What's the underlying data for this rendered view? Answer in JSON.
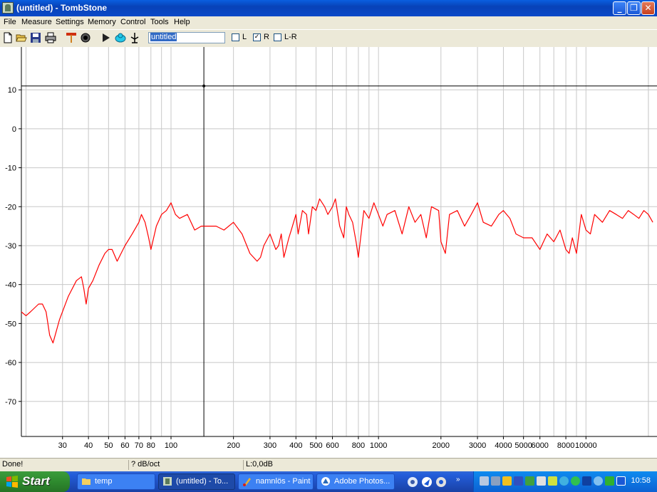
{
  "window": {
    "title": "(untitled) - TombStone",
    "minimize_glyph": "_",
    "maximize_glyph": "❐",
    "close_glyph": "✕"
  },
  "menu": [
    "File",
    "Measure",
    "Settings",
    "Memory",
    "Control",
    "Tools",
    "Help"
  ],
  "toolbar": {
    "icons": [
      "new-icon",
      "open-icon",
      "save-icon",
      "print-icon",
      "marker-icon",
      "record-icon",
      "play-icon",
      "loop-icon",
      "tuning-fork-icon"
    ],
    "name_value": "untitled",
    "checkboxes": [
      {
        "label": "L",
        "checked": false
      },
      {
        "label": "R",
        "checked": true
      },
      {
        "label": "L-R",
        "checked": false
      }
    ]
  },
  "chart_data": {
    "type": "line",
    "x_scale": "log",
    "xlim": [
      19,
      22000
    ],
    "ylim": [
      -79,
      21
    ],
    "x_tick_labels": [
      "30",
      "40",
      "50",
      "60",
      "70",
      "80",
      "100",
      "200",
      "300",
      "400",
      "500",
      "600",
      "800",
      "1000",
      "2000",
      "3000",
      "4000",
      "5000",
      "6000",
      "8000",
      "10000"
    ],
    "y_tick_labels": [
      "10",
      "0",
      "-10",
      "-20",
      "-30",
      "-40",
      "-50",
      "-60",
      "-70"
    ],
    "grid": true,
    "cursor": {
      "x": 144,
      "y": 11
    },
    "series": [
      {
        "color": "#ff0000",
        "x": [
          19,
          20,
          21,
          23,
          24,
          25,
          26,
          27,
          29,
          32,
          35,
          37,
          38,
          39,
          40,
          42,
          45,
          48,
          50,
          52,
          55,
          60,
          65,
          70,
          72,
          75,
          78,
          80,
          85,
          90,
          95,
          100,
          105,
          110,
          120,
          130,
          140,
          150,
          165,
          180,
          200,
          220,
          240,
          260,
          270,
          280,
          300,
          320,
          330,
          340,
          350,
          370,
          380,
          400,
          410,
          430,
          450,
          460,
          480,
          500,
          520,
          550,
          570,
          600,
          620,
          650,
          680,
          700,
          720,
          750,
          780,
          800,
          850,
          900,
          950,
          1000,
          1050,
          1100,
          1200,
          1300,
          1400,
          1500,
          1600,
          1700,
          1800,
          1950,
          2000,
          2100,
          2200,
          2400,
          2600,
          2800,
          3000,
          3200,
          3500,
          3800,
          4000,
          4300,
          4600,
          5000,
          5500,
          6000,
          6500,
          7000,
          7500,
          8000,
          8300,
          8600,
          9000,
          9500,
          10000,
          10500,
          11000,
          12000,
          13000,
          14000,
          15000,
          16000,
          17000,
          18000,
          19000,
          20000,
          21000
        ],
        "y": [
          -47,
          -48,
          -47,
          -45,
          -45,
          -47,
          -53,
          -55,
          -49,
          -43,
          -39,
          -38,
          -41,
          -45,
          -41,
          -39,
          -35,
          -32,
          -31,
          -31,
          -34,
          -30,
          -27,
          -24,
          -22,
          -24,
          -28,
          -31,
          -25,
          -22,
          -21,
          -19,
          -22,
          -23,
          -22,
          -26,
          -25,
          -25,
          -25,
          -26,
          -24,
          -27,
          -32,
          -34,
          -33,
          -30,
          -27,
          -31,
          -30,
          -27,
          -33,
          -28,
          -26,
          -22,
          -27,
          -21,
          -22,
          -27,
          -20,
          -21,
          -18,
          -20,
          -22,
          -20,
          -18,
          -25,
          -28,
          -20,
          -22,
          -24,
          -29,
          -33,
          -21,
          -23,
          -19,
          -22,
          -25,
          -22,
          -21,
          -27,
          -20,
          -24,
          -22,
          -28,
          -20,
          -21,
          -29,
          -32,
          -22,
          -21,
          -25,
          -22,
          -19,
          -24,
          -25,
          -22,
          -21,
          -23,
          -27,
          -28,
          -28,
          -31,
          -27,
          -29,
          -26,
          -31,
          -32,
          -28,
          -32,
          -22,
          -26,
          -27,
          -22,
          -24,
          -21,
          -22,
          -23,
          -21,
          -22,
          -23,
          -21,
          -22,
          -24
        ]
      }
    ]
  },
  "status": {
    "message": "Done!",
    "weighting": "? dB/oct",
    "level": "L:0,0dB"
  },
  "taskbar": {
    "start_label": "Start",
    "tasks": [
      {
        "label": "temp",
        "icon": "folder-icon",
        "active": false
      },
      {
        "label": "(untitled) - To...",
        "icon": "tombstone-icon",
        "active": true
      },
      {
        "label": "namnlös - Paint",
        "icon": "paint-icon",
        "active": false
      },
      {
        "label": "Adobe Photos...",
        "icon": "photoshop-icon",
        "active": false
      }
    ],
    "clock": "10:58"
  }
}
